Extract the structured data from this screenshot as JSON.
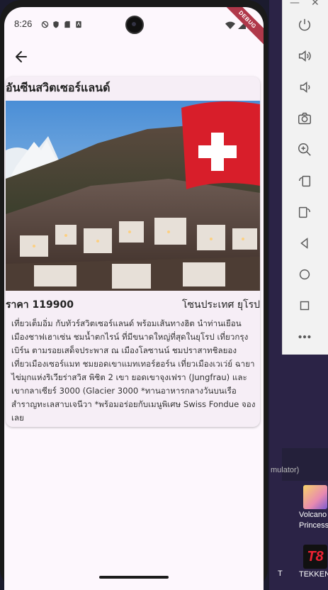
{
  "status": {
    "time": "8:26"
  },
  "debug_label": "DEBUG",
  "trip": {
    "title": "อันซีนสวิตเซอร์แลนด์",
    "image": "switzerland-zermatt-photo",
    "price": "ราคา 119900",
    "zone": "โซนประเทศ ยุโรป",
    "description": "เที่ยวเต็มอิ่ม กับทัวร์สวิตเซอร์แลนด์ พร้อมเส้นทางฮิต นำท่านเยือนเมืองชาฟเฮาเซ่น ชมน้ำตกไรน์ ที่มีขนาดใหญ่ที่สุดในยุโรป เที่ยวกรุงเบิร์น ตามรอยเสด็จประพาส ณ เมืองโลซานน์ ชมปราสาทชิลยอง เที่ยวเมืองเซอร์แมท ชมยอดเขาแมทเทอร์ฮอร์น เที่ยวเมืองเวเว่ย์ ฉายา ไข่มุกแห่งริเวียร่าสวิส พิชิต 2 เขา ยอดเขาจุงเฟรา (Jungfrau) และ เขากลาเซียร์ 3000 (Glacier 3000 *ทานอาหารกลางวันบนเรือสำราญทะเลสาบเจนีวา *พร้อมอร่อยกับเมนูพิเศษ Swiss Fondue จองเลย"
  },
  "desktop": {
    "taskbar_text": "mulator)",
    "icons": [
      {
        "label": "Volcano",
        "label2": "Princess"
      },
      {
        "label": "TEKKEN",
        "label2": ""
      }
    ],
    "prefix_t": "T"
  }
}
